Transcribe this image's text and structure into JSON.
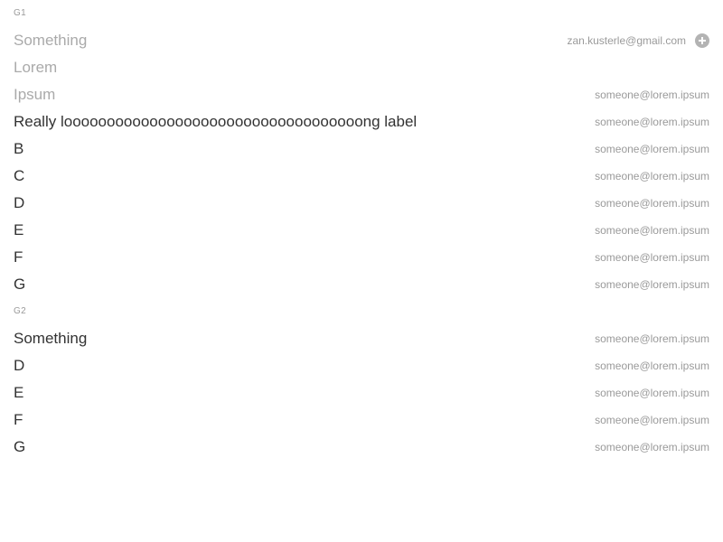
{
  "groups": [
    {
      "header": "G1",
      "items": [
        {
          "label": "Something",
          "email": "zan.kusterle@gmail.com",
          "disabled": true,
          "action_icon": "plus-circle-icon"
        },
        {
          "label": "Lorem",
          "email": "",
          "disabled": true
        },
        {
          "label": "Ipsum",
          "email": "someone@lorem.ipsum",
          "disabled": true
        },
        {
          "label": "Really looooooooooooooooooooooooooooooooooong label",
          "email": "someone@lorem.ipsum",
          "disabled": false
        },
        {
          "label": "B",
          "email": "someone@lorem.ipsum",
          "disabled": false
        },
        {
          "label": "C",
          "email": "someone@lorem.ipsum",
          "disabled": false
        },
        {
          "label": "D",
          "email": "someone@lorem.ipsum",
          "disabled": false
        },
        {
          "label": "E",
          "email": "someone@lorem.ipsum",
          "disabled": false
        },
        {
          "label": "F",
          "email": "someone@lorem.ipsum",
          "disabled": false
        },
        {
          "label": "G",
          "email": "someone@lorem.ipsum",
          "disabled": false
        }
      ]
    },
    {
      "header": "G2",
      "items": [
        {
          "label": "Something",
          "email": "someone@lorem.ipsum",
          "disabled": false
        },
        {
          "label": "D",
          "email": "someone@lorem.ipsum",
          "disabled": false
        },
        {
          "label": "E",
          "email": "someone@lorem.ipsum",
          "disabled": false
        },
        {
          "label": "F",
          "email": "someone@lorem.ipsum",
          "disabled": false
        },
        {
          "label": "G",
          "email": "someone@lorem.ipsum",
          "disabled": false
        }
      ]
    }
  ]
}
